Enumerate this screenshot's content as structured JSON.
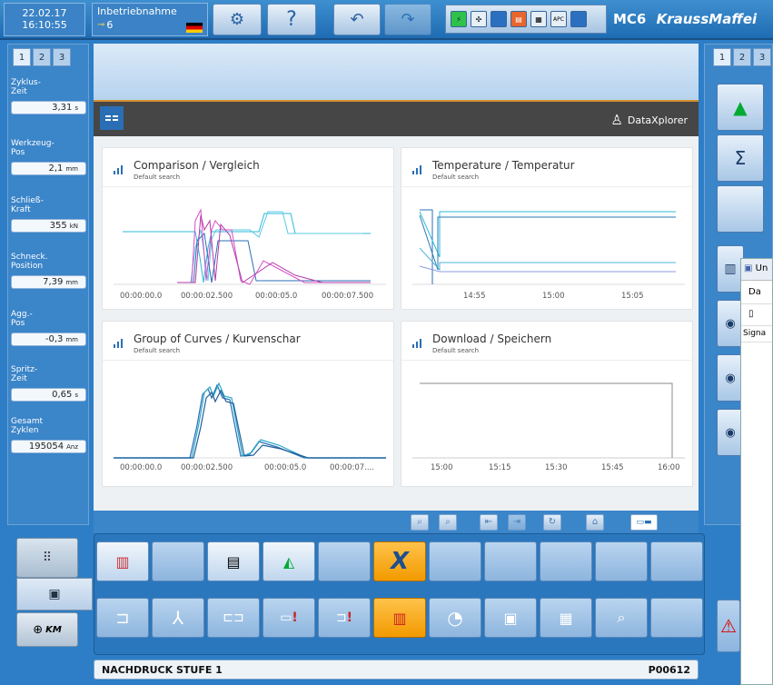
{
  "topbar": {
    "date": "22.02.17",
    "time": "16:10:55",
    "mode_label": "Inbetriebnahme",
    "mode_value": "6",
    "brand_model": "MC6",
    "brand_name": "KraussMaffei",
    "status_icons": [
      "green-status",
      "fan",
      "blank",
      "red-heater",
      "printer",
      "apc",
      "blank"
    ],
    "status_apc": "APC"
  },
  "left_panel": {
    "tabs": [
      "1",
      "2",
      "3"
    ],
    "items": [
      {
        "label": "Zyklus-\nZeit",
        "value": "3,31",
        "unit": "s"
      },
      {
        "label": "Werkzeug-\nPos",
        "value": "2,1",
        "unit": "mm"
      },
      {
        "label": "Schließ-\nKraft",
        "value": "355",
        "unit": "kN"
      },
      {
        "label": "Schneck.\nPosition",
        "value": "7,39",
        "unit": "mm"
      },
      {
        "label": "Agg.-\nPos",
        "value": "-0,3",
        "unit": "mm"
      },
      {
        "label": "Spritz-\nZeit",
        "value": "0,65",
        "unit": "s"
      },
      {
        "label": "Gesamt\nZyklen",
        "value": "195054",
        "unit": "Anz"
      }
    ]
  },
  "right_panel": {
    "tabs": [
      "1",
      "2",
      "3"
    ],
    "popup": {
      "title": "Un",
      "menu": "Da",
      "signal": "Signa"
    }
  },
  "dataxplorer": {
    "title": "DataXplorer",
    "colors": {
      "bar": "#464646",
      "accent": "#d59230",
      "link": "#2a6fb5"
    }
  },
  "cards": [
    {
      "title": "Comparison / Vergleich",
      "subtitle": "Default search",
      "ticks": [
        "00:00:00.0",
        "00:00:02.500",
        "00:00:05.0",
        "00:00:07.500"
      ]
    },
    {
      "title": "Temperature / Temperatur",
      "subtitle": "Default search",
      "ticks": [
        "14:55",
        "15:00",
        "15:05"
      ]
    },
    {
      "title": "Group of Curves / Kurvenschar",
      "subtitle": "Default search",
      "ticks": [
        "00:00:00.0",
        "00:00:02.500",
        "00:00:05.0",
        "00:00:07...."
      ]
    },
    {
      "title": "Download / Speichern",
      "subtitle": "Default search",
      "ticks": [
        "15:00",
        "15:15",
        "15:30",
        "15:45",
        "16:00"
      ]
    }
  ],
  "bottom": {
    "status_text": "NACHDRUCK STUFE 1",
    "status_code": "P00612",
    "km_label": "KM"
  }
}
